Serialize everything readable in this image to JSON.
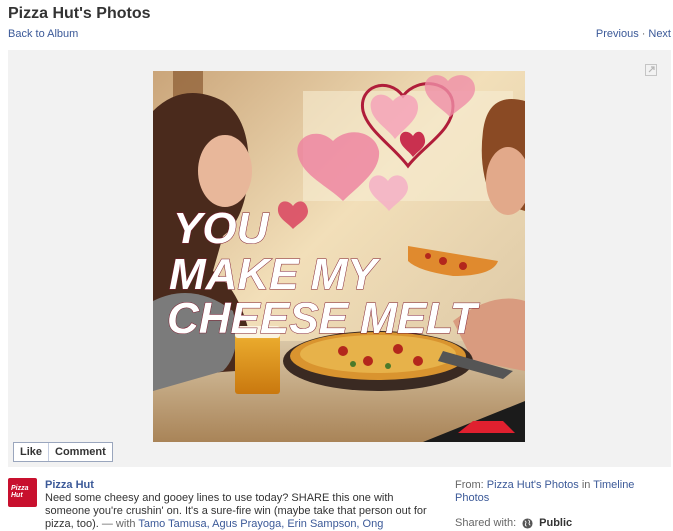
{
  "page": {
    "title": "Pizza Hut's Photos",
    "back_label": "Back to Album",
    "previous_label": "Previous",
    "separator": "·",
    "next_label": "Next"
  },
  "photo": {
    "headline": [
      "YOU",
      "MAKE MY",
      "CHEESE MELT"
    ]
  },
  "actions": {
    "like_label": "Like",
    "comment_label": "Comment"
  },
  "post": {
    "author": "Pizza Hut",
    "avatar_text": "Pizza Hut",
    "caption": "Need some cheesy and gooey lines to use today? SHARE this one with someone you're crushin' on. It's a sure-fire win (maybe take that person out for pizza, too).",
    "with_prefix": "— with",
    "tagged": "Tamo Tamusa, Agus Prayoga, Erin Sampson, Ong"
  },
  "meta": {
    "from_label": "From:",
    "from_link": "Pizza Hut's Photos",
    "in_word": "in",
    "album_link": "Timeline Photos",
    "shared_label": "Shared with:",
    "privacy": "Public"
  },
  "icons": {
    "expand": "expand-icon",
    "globe": "globe-icon"
  },
  "colors": {
    "link": "#3b5998",
    "brand_red": "#c8102e"
  }
}
